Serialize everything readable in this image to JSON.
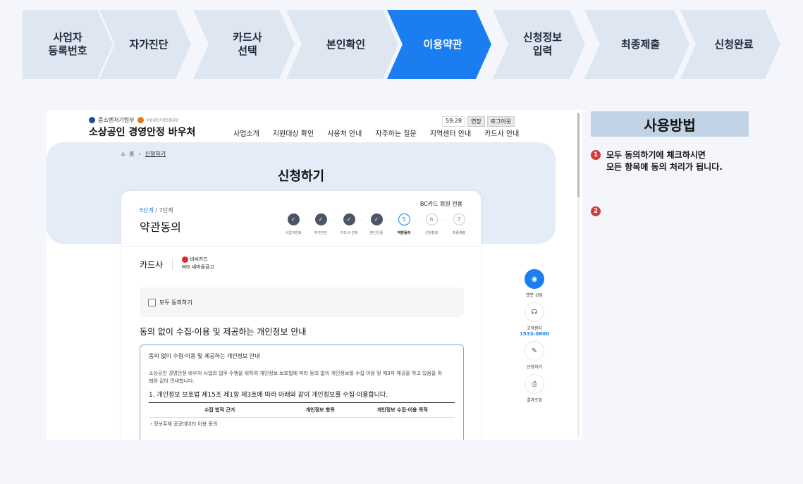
{
  "steps": [
    {
      "label": "사업자\n등록번호",
      "active": false
    },
    {
      "label": "자가진단",
      "active": false
    },
    {
      "label": "카드사\n선택",
      "active": false
    },
    {
      "label": "본인확인",
      "active": false
    },
    {
      "label": "이용약관",
      "active": true
    },
    {
      "label": "신청정보\n입력",
      "active": false
    },
    {
      "label": "최종제출",
      "active": false
    },
    {
      "label": "신청완료",
      "active": false
    }
  ],
  "site": {
    "ministry": "중소벤처기업부",
    "agency": "소상공인시장진흥공단",
    "title": "소상공인 경영안정 바우처",
    "nav": [
      "사업소개",
      "지원대상 확인",
      "사용처 안내",
      "자주하는 질문",
      "지역센터 안내",
      "카드사 안내"
    ],
    "timer": "59:28",
    "extend_label": "연장",
    "logout_label": "로그아웃"
  },
  "breadcrumb": {
    "home": "홈",
    "current": "신청하기"
  },
  "hero_title": "신청하기",
  "card": {
    "bc_note": "BC카드 회원 전용",
    "step_current": "5단계",
    "step_total": " / 7단계",
    "title": "약관동의",
    "mini_steps": [
      {
        "label": "사업자번호",
        "state": "done",
        "num": "✓"
      },
      {
        "label": "자가진단",
        "state": "done",
        "num": "✓"
      },
      {
        "label": "카드사 선택",
        "state": "done",
        "num": "✓"
      },
      {
        "label": "본인인증",
        "state": "done",
        "num": "✓"
      },
      {
        "label": "약관동의",
        "state": "cur",
        "num": "5"
      },
      {
        "label": "신청정보",
        "state": "todo",
        "num": "6"
      },
      {
        "label": "최종제출",
        "state": "todo",
        "num": "7"
      }
    ],
    "card_company_label": "카드사",
    "brand_name": "비씨카드",
    "brand_sub": "MG 새마을금고",
    "agree_all": "모두 동의하기",
    "section_head": "동의 없이 수집·이용 및 제공하는 개인정보 안내",
    "consent": {
      "heading": "동의 없이 수집·이용 및 제공하는 개인정보 안내",
      "paragraph": "소상공인 경영안정 바우처 사업의 업무 수행을 위하여 개인정보 보호법에 따라 동의 없이 개인정보를 수집·이용 및 제3자 제공을 하고 있음을 아래와 같이 안내합니다.",
      "subheading": "1. 개인정보 보호법 제15조 제1항 제3호에 따라 아래와 같이 개인정보를 수집·이용합니다.",
      "columns": [
        "수집 법적 근거",
        "개인정보 항목",
        "개인정보 수집·이용 목적"
      ],
      "row_first": "・정보주체 공공데이터 이용 동의"
    }
  },
  "tools": [
    {
      "label": "챗봇 상담",
      "icon": "chat-icon",
      "glyph": "◉"
    },
    {
      "label": "고객센터",
      "phone": "1533-0600",
      "icon": "headset-icon",
      "glyph": "☊"
    },
    {
      "label": "신청하기",
      "icon": "edit-icon",
      "glyph": "✎"
    },
    {
      "label": "결과조회",
      "icon": "document-search-icon",
      "glyph": "⎙"
    }
  ],
  "help": {
    "title": "사용방법",
    "items": [
      {
        "num": "1",
        "text": "모두 동의하기에 체크하시면\n모든 항목에 동의 처리가 됩니다."
      },
      {
        "num": "2",
        "text": ""
      }
    ]
  },
  "colors": {
    "accent": "#1a7ef0",
    "step_bg": "#dde6f1",
    "help_head_bg": "#c2d3e6",
    "marker": "#cf3b3b"
  }
}
